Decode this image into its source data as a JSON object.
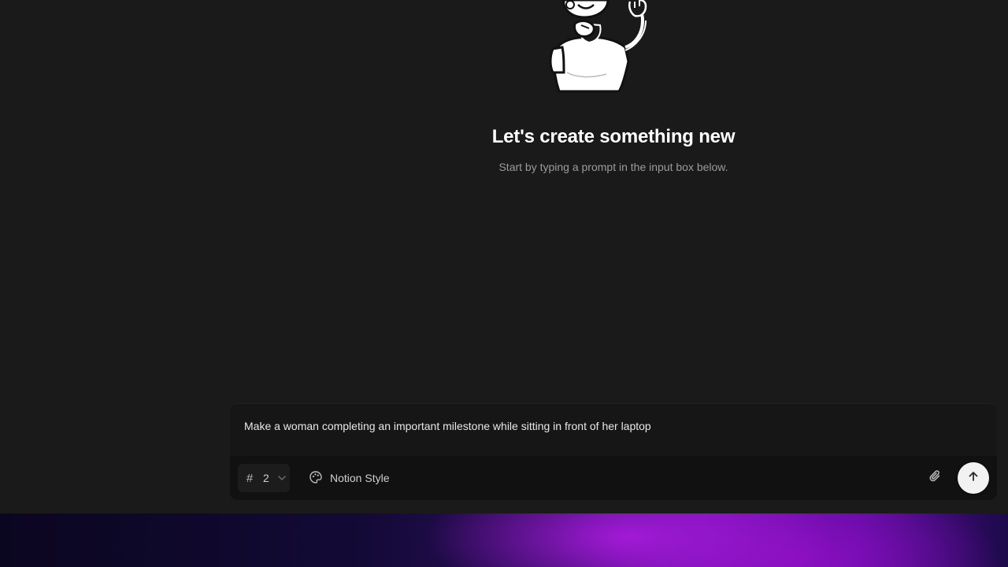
{
  "hero": {
    "title": "Let's create something new",
    "subtitle": "Start by typing a prompt in the input box below."
  },
  "composer": {
    "prompt_value": "Make a woman completing an important milestone while sitting in front of her laptop",
    "count_icon": "hash-icon",
    "count_value": "2",
    "style_icon": "palette-icon",
    "style_label": "Notion Style",
    "attach_icon": "paperclip-icon",
    "send_icon": "arrow-up-icon"
  },
  "colors": {
    "background": "#1a1a1a",
    "title": "#ffffff",
    "subtitle": "#9b9b9b",
    "send_button": "#f2f2f2"
  }
}
